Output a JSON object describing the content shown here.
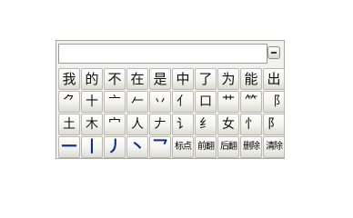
{
  "input": {
    "value": ""
  },
  "rows": [
    {
      "kind": "char",
      "keys": [
        "我",
        "的",
        "不",
        "在",
        "是",
        "中",
        "了",
        "为",
        "能",
        "出"
      ]
    },
    {
      "kind": "radical",
      "keys": [
        "⺈",
        "十",
        "亠",
        "𠂉",
        "丷",
        "亻",
        "口",
        "艹",
        "⺮",
        "⻏"
      ]
    },
    {
      "kind": "radical",
      "keys": [
        "土",
        "木",
        "宀",
        "人",
        "𠂇",
        "讠",
        "纟",
        "女",
        "忄",
        "阝"
      ]
    },
    {
      "kind": "stroke",
      "keys": [
        "一",
        "丨",
        "丿",
        "丶",
        "乛"
      ]
    }
  ],
  "function_keys": [
    {
      "id": "punctuation",
      "label": "标点"
    },
    {
      "id": "page-prev",
      "label": "前翻"
    },
    {
      "id": "page-next",
      "label": "后翻"
    },
    {
      "id": "delete",
      "label": "删除"
    },
    {
      "id": "clear",
      "label": "清除"
    }
  ],
  "colors": {
    "stroke_keys": "#0b2a8a",
    "panel_bg": "#f1f1ee"
  },
  "icons": {
    "collapse": "minus-icon"
  }
}
